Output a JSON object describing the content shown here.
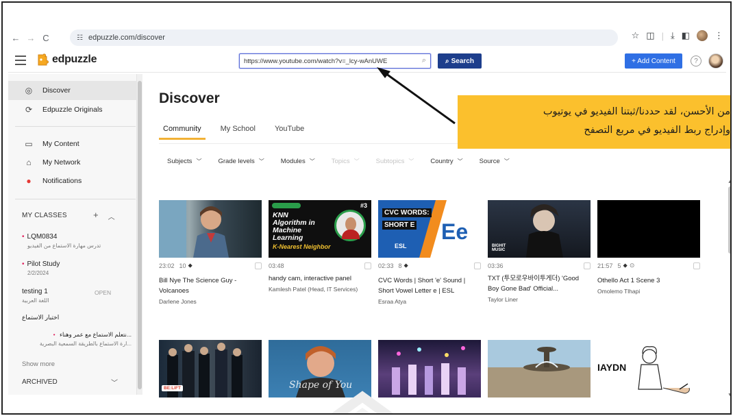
{
  "browser": {
    "url": "edpuzzle.com/discover"
  },
  "header": {
    "logo_text": "edpuzzle",
    "search_value": "https://www.youtube.com/watch?v=_lcy-wAnUWE",
    "search_button": "Search",
    "add_content_button": "+ Add Content",
    "help_label": "?"
  },
  "sidebar": {
    "items": [
      {
        "label": "Discover",
        "icon": "compass-icon"
      },
      {
        "label": "Edpuzzle Originals",
        "icon": "edpuzzle-originals-icon"
      },
      {
        "label": "My Content",
        "icon": "folder-icon"
      },
      {
        "label": "My Network",
        "icon": "network-icon"
      },
      {
        "label": "Notifications",
        "icon": "bell-icon"
      }
    ],
    "my_classes_label": "MY CLASSES",
    "classes": [
      {
        "name": "LQM0834",
        "sub": "تدرس مهارة الاستماع من الفيديو"
      },
      {
        "name": "Pilot Study",
        "sub": "2/2/2024"
      },
      {
        "name": "testing 1",
        "sub": "اللغة العربية",
        "tag": "OPEN"
      },
      {
        "name": "اختبار الاستماع",
        "sub": ""
      },
      {
        "name": "...نتعلم الاستماع مع عمر وهناء",
        "sub": "...ارة الاستماع بالطريقة السمعية البصرية"
      }
    ],
    "show_more": "Show more",
    "archived": "ARCHIVED"
  },
  "main": {
    "title": "Discover",
    "tabs": [
      "Community",
      "My School",
      "YouTube"
    ],
    "filters": [
      {
        "label": "Subjects",
        "enabled": true
      },
      {
        "label": "Grade levels",
        "enabled": true
      },
      {
        "label": "Modules",
        "enabled": true
      },
      {
        "label": "Topics",
        "enabled": false
      },
      {
        "label": "Subtopics",
        "enabled": false
      },
      {
        "label": "Country",
        "enabled": true
      },
      {
        "label": "Source",
        "enabled": true
      }
    ],
    "cards": [
      {
        "duration": "23:02",
        "count": "10",
        "title": "Bill Nye The Science Guy - Volcanoes",
        "author": "Darlene Jones"
      },
      {
        "duration": "03:48",
        "count": "",
        "title": "handy cam, interactive panel",
        "author": "Kamlesh Patel (Head, IT Services)"
      },
      {
        "duration": "02:33",
        "count": "8",
        "title": "CVC Words | Short 'e' Sound | Short Vowel Letter e | ESL",
        "author": "Esraa Atya"
      },
      {
        "duration": "03:36",
        "count": "",
        "title": "TXT (투모로우바이투게더) 'Good Boy Gone Bad' Official...",
        "author": "Taylor Liner"
      },
      {
        "duration": "21:57",
        "count": "5",
        "title": "Othello Act 1 Scene 3",
        "author": "Omolemo Tlhapi"
      }
    ],
    "thumb_text": {
      "knn_badge": "#3",
      "knn_line1": "KNN",
      "knn_line2": "Algorithm in",
      "knn_line3": "Machine",
      "knn_line4": "Learning",
      "knn_line5": "K-Nearest Neighbor",
      "cvc_line1": "CVC WORDS:",
      "cvc_line2": "SHORT E",
      "cvc_ee": "Ee",
      "cvc_esl": "ESL",
      "txt_logo": "BIGHIT MUSIC",
      "r2a_logo": "BE:LIFT",
      "r2b_caption": "Shape of You",
      "r2e_text": "IAYDN"
    }
  },
  "callout": {
    "line1": "من الأحسن، لقد حددنا/ثبتنا الفيديو في يوتيوب",
    "line2": "وإدراج ربط الفيديو في مربع التصفح"
  },
  "colors": {
    "accent_yellow": "#f2b135",
    "search_button_bg": "#1d3e8c",
    "add_button_bg": "#2f6fe4",
    "callout_bg": "#fbc02d"
  }
}
